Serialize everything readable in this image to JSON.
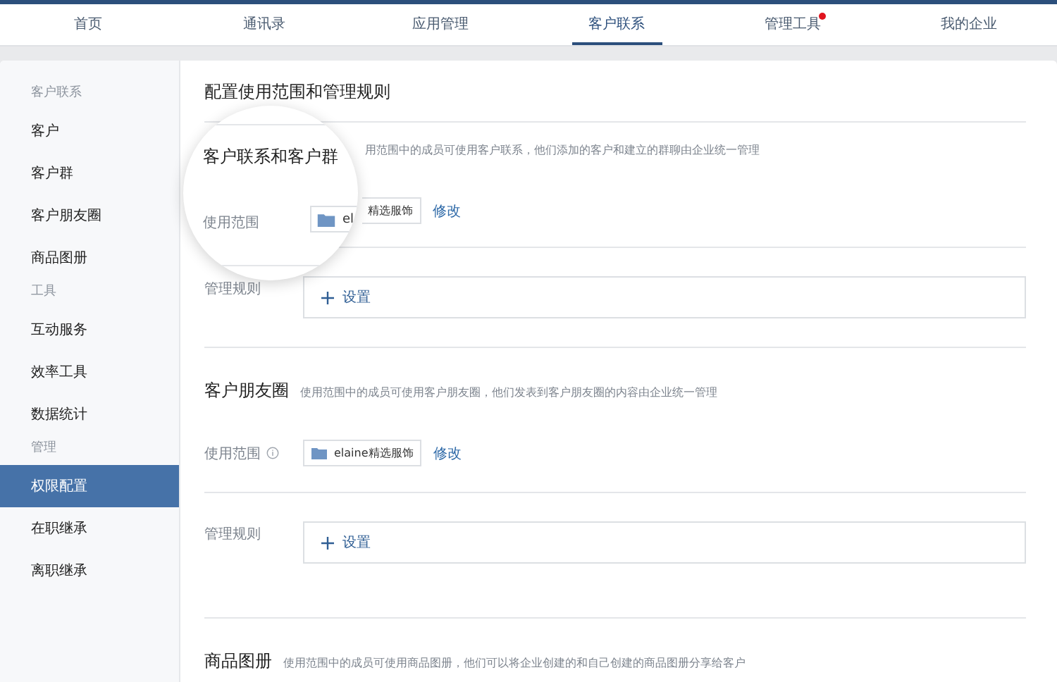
{
  "tabs": [
    {
      "label": "首页",
      "selected": false,
      "badge": false
    },
    {
      "label": "通讯录",
      "selected": false,
      "badge": false
    },
    {
      "label": "应用管理",
      "selected": false,
      "badge": false
    },
    {
      "label": "客户联系",
      "selected": true,
      "badge": false
    },
    {
      "label": "管理工具",
      "selected": false,
      "badge": true
    },
    {
      "label": "我的企业",
      "selected": false,
      "badge": false
    }
  ],
  "sidebar": {
    "groups": [
      {
        "heading": "客户联系",
        "items": [
          {
            "label": "客户",
            "selected": false
          },
          {
            "label": "客户群",
            "selected": false
          },
          {
            "label": "客户朋友圈",
            "selected": false
          },
          {
            "label": "商品图册",
            "selected": false
          }
        ]
      },
      {
        "heading": "工具",
        "items": [
          {
            "label": "互动服务",
            "selected": false
          },
          {
            "label": "效率工具",
            "selected": false
          },
          {
            "label": "数据统计",
            "selected": false
          }
        ]
      },
      {
        "heading": "管理",
        "items": [
          {
            "label": "权限配置",
            "selected": true
          },
          {
            "label": "在职继承",
            "selected": false
          },
          {
            "label": "离职继承",
            "selected": false
          }
        ]
      }
    ]
  },
  "page_title": "配置使用范围和管理规则",
  "sections": [
    {
      "kind": "magnified",
      "magnifier": {
        "title": "客户联系和客户群",
        "scope_label": "使用范围",
        "chip_text": "el"
      },
      "description": "用范围中的成员可使用客户联系，他们添加的客户和建立的群聊由企业统一管理",
      "scope": {
        "chip_text": "精选服饰",
        "action": "修改"
      },
      "rules": {
        "label": "管理规则",
        "button": "设置"
      }
    },
    {
      "kind": "plain",
      "title": "客户朋友圈",
      "description": "使用范围中的成员可使用客户朋友圈，他们发表到客户朋友圈的内容由企业统一管理",
      "scope": {
        "label": "使用范围",
        "info": true,
        "chip_text": "elaine精选服饰",
        "action": "修改"
      },
      "rules": {
        "label": "管理规则",
        "button": "设置"
      }
    },
    {
      "kind": "plain",
      "title": "商品图册",
      "description": "使用范围中的成员可使用商品图册，他们可以将企业创建的和自己创建的商品图册分享给客户"
    }
  ]
}
